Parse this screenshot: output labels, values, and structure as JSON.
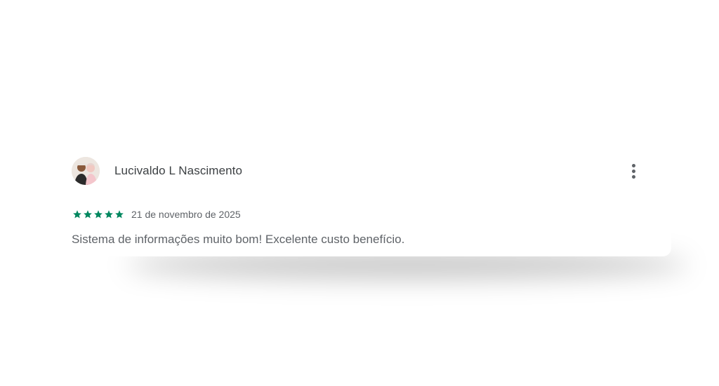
{
  "review": {
    "reviewer_name": "Lucivaldo L Nascimento",
    "avatar_icon": "reviewer-photo",
    "rating": 5,
    "rating_max": 5,
    "date": "21 de novembro de 2025",
    "text": "Sistema de informações muito bom! Excelente custo benefício.",
    "more_icon": "more-vert-icon"
  },
  "colors": {
    "star": "#01875f",
    "name": "#3c4043",
    "secondary_text": "#5f6368"
  }
}
